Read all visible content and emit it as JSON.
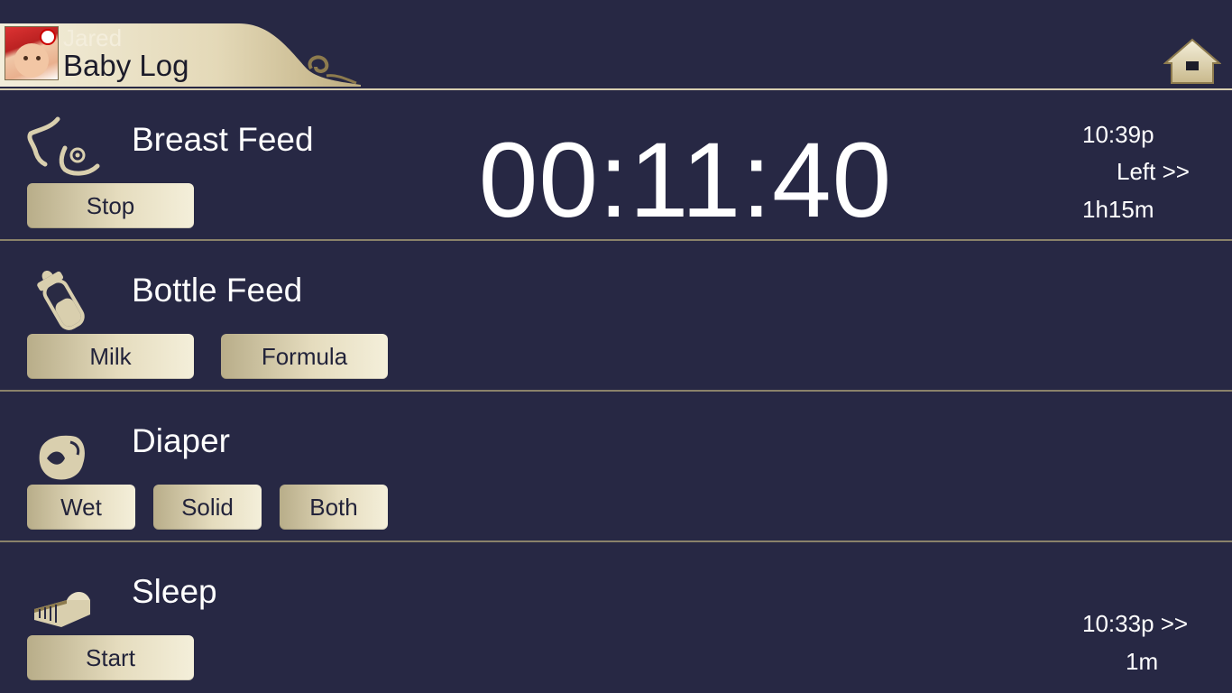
{
  "header": {
    "baby_name": "Jared",
    "app_title": "Baby Log"
  },
  "colors": {
    "background": "#272844",
    "gold_light": "#f4efda",
    "gold_dark": "#b8ad89",
    "button_text": "#22233a"
  },
  "breast_feed": {
    "title": "Breast Feed",
    "stop_label": "Stop",
    "timer": "00:11:40",
    "last_time": "10:39p",
    "side": "Left >>",
    "interval": "1h15m"
  },
  "bottle_feed": {
    "title": "Bottle Feed",
    "milk_label": "Milk",
    "formula_label": "Formula"
  },
  "diaper": {
    "title": "Diaper",
    "wet_label": "Wet",
    "solid_label": "Solid",
    "both_label": "Both"
  },
  "sleep": {
    "title": "Sleep",
    "start_label": "Start",
    "last_time": "10:33p >>",
    "duration": "1m"
  }
}
